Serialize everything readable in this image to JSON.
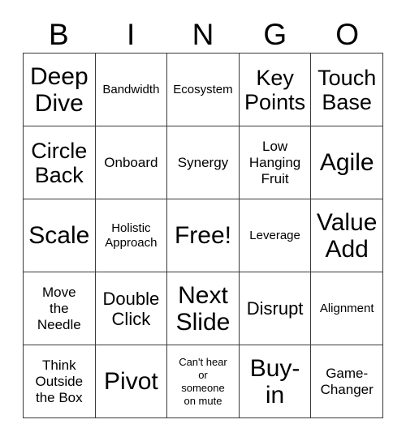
{
  "card": {
    "title_letters": [
      "B",
      "I",
      "N",
      "G",
      "O"
    ],
    "columns": 5,
    "rows": 5,
    "free_space_label": "Free!",
    "border_color": "#3a3a3a",
    "text_color": "#000000",
    "background_color": "#ffffff",
    "cells": [
      [
        {
          "text": "Deep\nDive",
          "size": "xl"
        },
        {
          "text": "Bandwidth",
          "size": "xs"
        },
        {
          "text": "Ecosystem",
          "size": "xs"
        },
        {
          "text": "Key\nPoints",
          "size": "lg"
        },
        {
          "text": "Touch\nBase",
          "size": "lg"
        }
      ],
      [
        {
          "text": "Circle\nBack",
          "size": "lg"
        },
        {
          "text": "Onboard",
          "size": "sm"
        },
        {
          "text": "Synergy",
          "size": "sm"
        },
        {
          "text": "Low\nHanging\nFruit",
          "size": "sm"
        },
        {
          "text": "Agile",
          "size": "xl"
        }
      ],
      [
        {
          "text": "Scale",
          "size": "xl"
        },
        {
          "text": "Holistic\nApproach",
          "size": "xs"
        },
        {
          "text": "Free!",
          "size": "xl"
        },
        {
          "text": "Leverage",
          "size": "xs"
        },
        {
          "text": "Value\nAdd",
          "size": "xl"
        }
      ],
      [
        {
          "text": "Move\nthe\nNeedle",
          "size": "sm"
        },
        {
          "text": "Double\nClick",
          "size": "md"
        },
        {
          "text": "Next\nSlide",
          "size": "xl"
        },
        {
          "text": "Disrupt",
          "size": "md"
        },
        {
          "text": "Alignment",
          "size": "xs"
        }
      ],
      [
        {
          "text": "Think\nOutside\nthe Box",
          "size": "sm"
        },
        {
          "text": "Pivot",
          "size": "xl"
        },
        {
          "text": "Can't hear\nor\nsomeone\non mute",
          "size": "xxs"
        },
        {
          "text": "Buy-\nin",
          "size": "xl"
        },
        {
          "text": "Game-\nChanger",
          "size": "sm"
        }
      ]
    ]
  }
}
